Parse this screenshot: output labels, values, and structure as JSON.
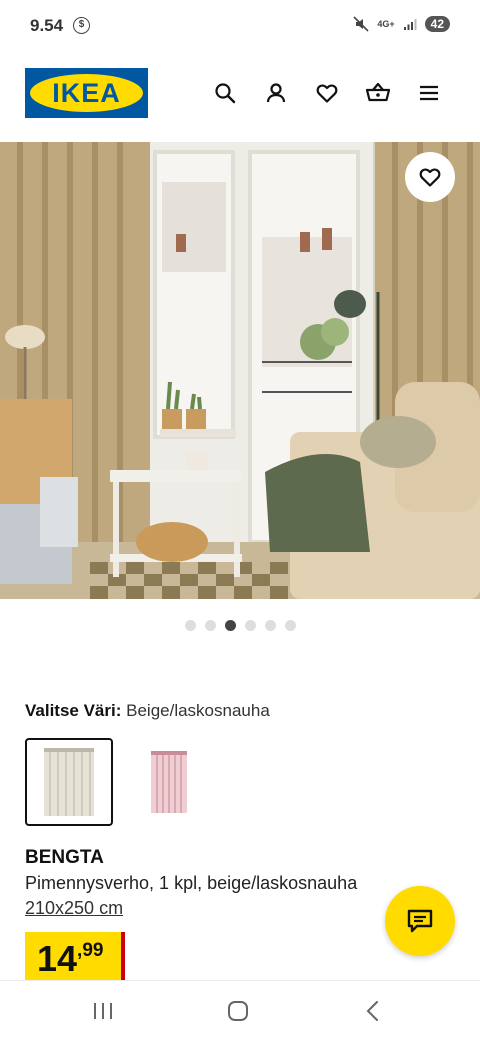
{
  "status_bar": {
    "time": "9.54",
    "sync_icon": "sync-circle-icon",
    "network": "4G+",
    "battery": "42"
  },
  "header": {
    "logo_text": "IKEA",
    "icons": [
      "search-icon",
      "profile-icon",
      "heart-icon",
      "basket-icon",
      "menu-icon"
    ]
  },
  "gallery": {
    "image_count": 6,
    "active_index": 2
  },
  "color_select": {
    "label": "Valitse Väri:",
    "value": "Beige/laskosnauha",
    "options": [
      "beige",
      "pink"
    ]
  },
  "product": {
    "name": "BENGTA",
    "description": "Pimennysverho, 1 kpl, beige/laskosnauha",
    "size": "210x250 cm",
    "price_main": "14",
    "price_decimal": ",99"
  },
  "colors": {
    "ikea_blue": "#0058a3",
    "ikea_yellow": "#ffdb00",
    "price_red": "#cc0008"
  }
}
